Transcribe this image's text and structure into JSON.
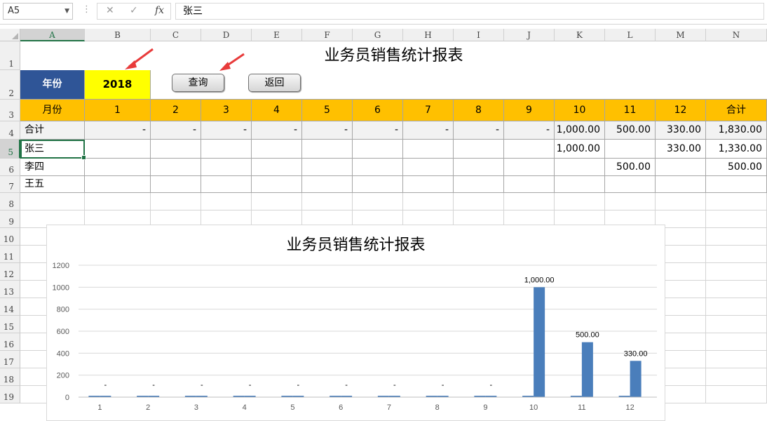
{
  "formula_bar": {
    "name_box": "A5",
    "cancel_icon": "✕",
    "enter_icon": "✓",
    "fx_label": "fx",
    "content": "张三"
  },
  "columns": [
    "A",
    "B",
    "C",
    "D",
    "E",
    "F",
    "G",
    "H",
    "I",
    "J",
    "K",
    "L",
    "M",
    "N"
  ],
  "rows": [
    "1",
    "2",
    "3",
    "4",
    "5",
    "6",
    "7",
    "8",
    "9",
    "10",
    "11",
    "12",
    "13",
    "14",
    "15",
    "16",
    "17",
    "18",
    "19"
  ],
  "sheet": {
    "title": "业务员销售统计报表",
    "year_label": "年份",
    "year_value": "2018",
    "query_button": "查询",
    "back_button": "返回",
    "month_label": "月份",
    "months": [
      "1",
      "2",
      "3",
      "4",
      "5",
      "6",
      "7",
      "8",
      "9",
      "10",
      "11",
      "12"
    ],
    "total_header": "合计",
    "table_rows": [
      {
        "name": "合计",
        "values": [
          "-",
          "-",
          "-",
          "-",
          "-",
          "-",
          "-",
          "-",
          "-",
          "1,000.00",
          "500.00",
          "330.00"
        ],
        "total": "1,830.00"
      },
      {
        "name": "张三",
        "values": [
          "",
          "",
          "",
          "",
          "",
          "",
          "",
          "",
          "",
          "1,000.00",
          "",
          "330.00"
        ],
        "total": "1,330.00"
      },
      {
        "name": "李四",
        "values": [
          "",
          "",
          "",
          "",
          "",
          "",
          "",
          "",
          "",
          "",
          "500.00",
          ""
        ],
        "total": "500.00"
      },
      {
        "name": "王五",
        "values": [
          "",
          "",
          "",
          "",
          "",
          "",
          "",
          "",
          "",
          "",
          "",
          ""
        ],
        "total": ""
      }
    ]
  },
  "colors": {
    "header_band": "#ffc000",
    "year_label_bg": "#2f5597",
    "year_value_bg": "#ffff00",
    "bar": "#4a7ebb",
    "selection": "#217346"
  },
  "chart_data": {
    "type": "bar",
    "title": "业务员销售统计报表",
    "categories": [
      "1",
      "2",
      "3",
      "4",
      "5",
      "6",
      "7",
      "8",
      "9",
      "10",
      "11",
      "12"
    ],
    "series": [
      {
        "values": [
          0,
          0,
          0,
          0,
          0,
          0,
          0,
          0,
          0,
          1000,
          500,
          330
        ]
      },
      {
        "values": [
          0,
          0,
          0,
          0,
          0,
          0,
          0,
          0,
          0,
          0,
          0,
          0
        ]
      }
    ],
    "data_labels": [
      "-",
      "-",
      "-",
      "-",
      "-",
      "-",
      "-",
      "-",
      "-",
      "1,000.00",
      "500.00",
      "330.00"
    ],
    "ylim": [
      0,
      1200
    ],
    "yticks": [
      "0",
      "200",
      "400",
      "600",
      "800",
      "1000",
      "1200"
    ],
    "grid": true
  }
}
